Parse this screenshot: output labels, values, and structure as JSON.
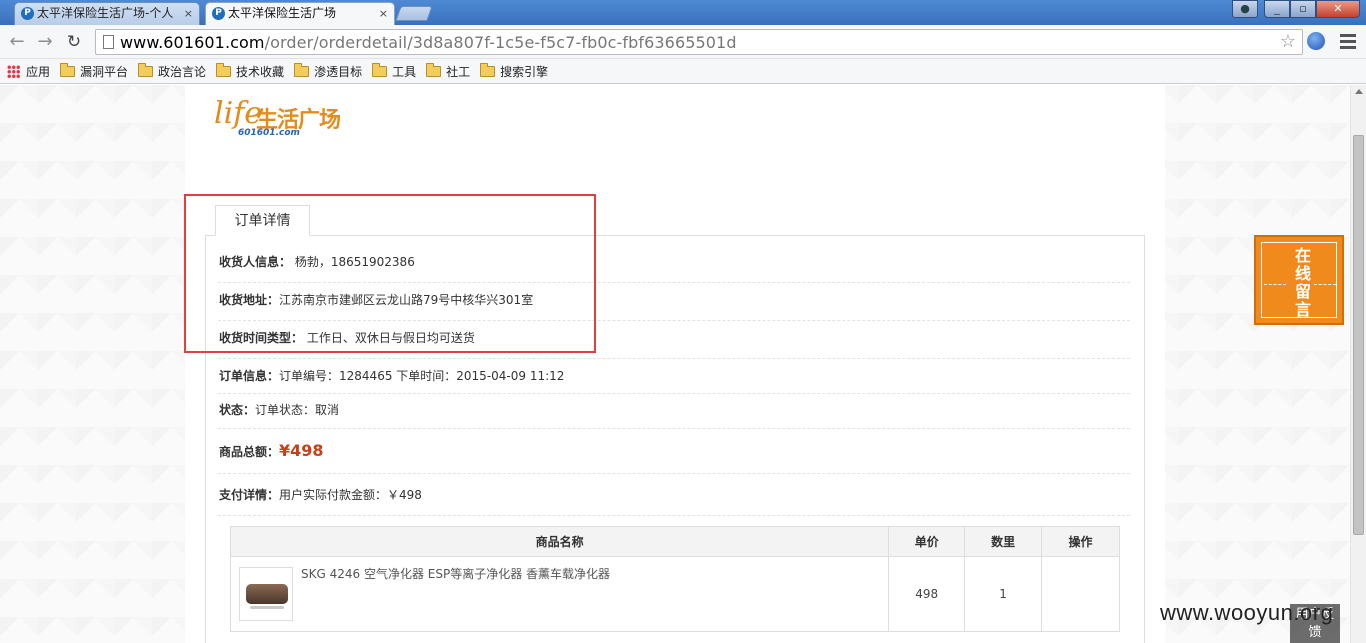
{
  "browser": {
    "tabs": [
      {
        "label": "太平洋保险生活广场-个人",
        "active": false
      },
      {
        "label": "太平洋保险生活广场",
        "active": true
      }
    ],
    "tab_close": "×",
    "url_host": "www.601601.com",
    "url_path": "/order/orderdetail/3d8a807f-1c5e-f5c7-fb0c-fbf63665501d",
    "bookmarks": [
      "应用",
      "漏洞平台",
      "政治言论",
      "技术收藏",
      "渗透目标",
      "工具",
      "社工",
      "搜索引擎"
    ]
  },
  "site": {
    "logo_life": "life",
    "logo_cn": "生活广场",
    "logo_domain": "601601.com"
  },
  "order": {
    "tab_title": "订单详情",
    "receiver_label": "收货人信息：",
    "receiver_value": "杨勃，18651902386",
    "address_label": "收货地址：",
    "address_value": "江苏南京市建邺区云龙山路79号中核华兴301室",
    "time_label": "收货时间类型：",
    "time_value": "工作日、双休日与假日均可送货",
    "info_label": "订单信息：",
    "info_value": "订单编号：1284465 下单时间：2015-04-09 11:12",
    "status_label": "状态：",
    "status_value": "订单状态：取消",
    "total_label": "商品总额：",
    "total_value": "¥498",
    "pay_label": "支付详情：",
    "pay_value": "用户实际付款金额：￥498"
  },
  "goods_table": {
    "headers": [
      "商品名称",
      "单价",
      "数里",
      "操作"
    ],
    "rows": [
      {
        "name": "SKG 4246 空气净化器 ESP等离子净化器 香薰车载净化器",
        "price": "498",
        "qty": "1",
        "action": ""
      }
    ]
  },
  "widgets": {
    "message": "在线留言",
    "feedback": "用户反馈",
    "watermark": "www.wooyun.org"
  },
  "colors": {
    "highlight": "#e04040",
    "price": "#c6401a",
    "widget": "#f08a1c",
    "logo": "#e58b1a"
  }
}
